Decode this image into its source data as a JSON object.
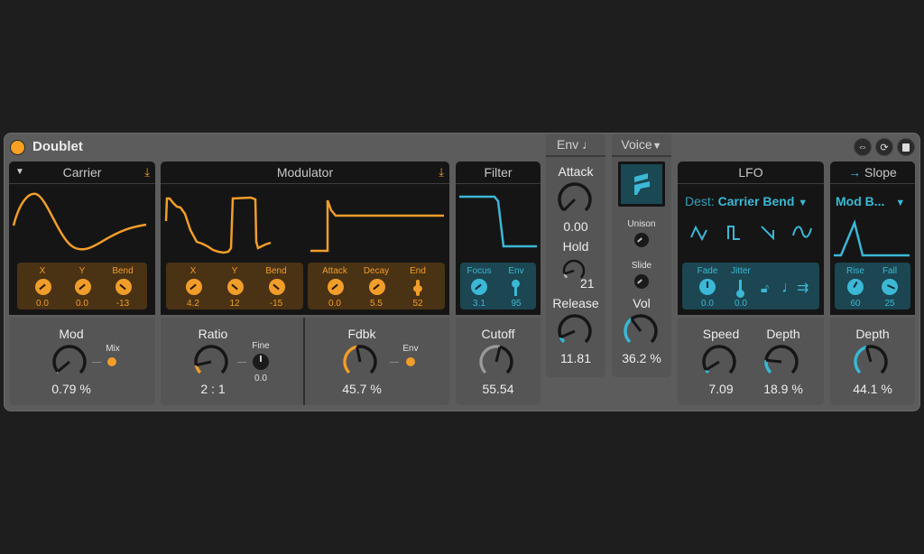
{
  "device": {
    "title": "Doublet",
    "power_on": true,
    "header_buttons": [
      {
        "icon": "hot-swap-icon"
      },
      {
        "icon": "reset-icon"
      },
      {
        "icon": "save-preset-icon"
      }
    ]
  },
  "colors": {
    "orange": "#f19d2a",
    "blue": "#3bb8d6",
    "panel_dark": "#151515",
    "panel_gray": "#555555"
  },
  "carrier": {
    "title": "Carrier",
    "collapse_icon": "triangle-down-icon",
    "download_icon": "download-icon",
    "params": [
      {
        "label": "X",
        "value": "0.0"
      },
      {
        "label": "Y",
        "value": "0.0"
      },
      {
        "label": "Bend",
        "value": "-13"
      }
    ],
    "mod": {
      "label": "Mod",
      "value": "0.79 %",
      "fraction": 0.02
    },
    "mix_label": "Mix"
  },
  "modulator": {
    "title": "Modulator",
    "download_icon": "download-icon",
    "params": [
      {
        "label": "X",
        "value": "4.2"
      },
      {
        "label": "Y",
        "value": "12"
      },
      {
        "label": "Bend",
        "value": "-15"
      }
    ],
    "env_params": [
      {
        "label": "Attack",
        "value": "0.0"
      },
      {
        "label": "Decay",
        "value": "5.5"
      },
      {
        "label": "End",
        "value": "52"
      }
    ],
    "ratio": {
      "label": "Ratio",
      "value": "2 : 1",
      "fraction": 0.12
    },
    "fine": {
      "label": "Fine",
      "value": "0.0"
    },
    "fdbk": {
      "label": "Fdbk",
      "value": "45.7 %",
      "fraction": 0.457
    },
    "env_label": "Env"
  },
  "filter": {
    "title": "Filter",
    "params": [
      {
        "label": "Focus",
        "value": "3.1"
      },
      {
        "label": "Env",
        "value": "95"
      }
    ],
    "cutoff": {
      "label": "Cutoff",
      "value": "55.54",
      "fraction": 0.55
    }
  },
  "env": {
    "title": "Env",
    "note_icon": "note-icon",
    "attack": {
      "label": "Attack",
      "value": "0.00",
      "fraction": 0.0
    },
    "hold": {
      "label": "Hold",
      "value": "21",
      "fraction": 0.1
    },
    "release": {
      "label": "Release",
      "value": "11.81",
      "fraction": 0.08
    }
  },
  "voice": {
    "title": "Voice",
    "dropdown_icon": "triangle-down-icon",
    "logo_icon": "doublet-logo-icon",
    "unison_label": "Unison",
    "slide_label": "Slide",
    "vol": {
      "label": "Vol",
      "value": "36.2 %",
      "fraction": 0.362
    }
  },
  "lfo": {
    "title": "LFO",
    "dest_label": "Dest:",
    "dest_value": "Carrier Bend",
    "waveforms": [
      "triangle-wave-icon",
      "square-wave-icon",
      "saw-wave-icon",
      "sine-wave-icon"
    ],
    "fade": {
      "label": "Fade",
      "value": "0.0"
    },
    "jitter": {
      "label": "Jitter",
      "value": "0.0"
    },
    "extra_icons": [
      "unlock-icon",
      "sync-note-icon",
      "retrigger-icon"
    ],
    "speed": {
      "label": "Speed",
      "value": "7.09",
      "fraction": 0.05
    },
    "depth": {
      "label": "Depth",
      "value": "18.9 %",
      "fraction": 0.189
    }
  },
  "slope": {
    "title": "Slope",
    "arrow_icon": "arrow-right-icon",
    "dest_value": "Mod B...",
    "params": [
      {
        "label": "Rise",
        "value": "60"
      },
      {
        "label": "Fall",
        "value": "25"
      }
    ],
    "depth": {
      "label": "Depth",
      "value": "44.1 %",
      "fraction": 0.441
    }
  }
}
